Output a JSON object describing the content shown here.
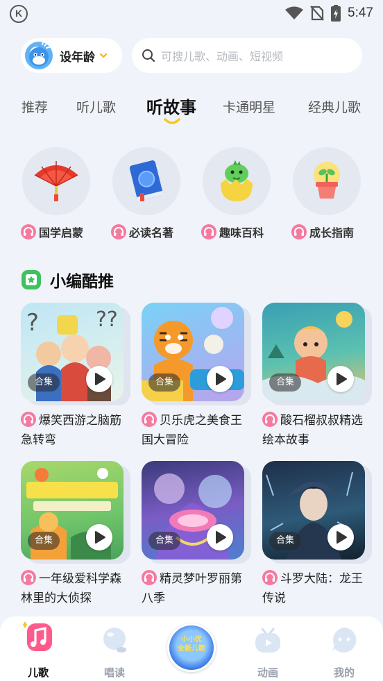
{
  "status_bar": {
    "app_logo": "K",
    "time": "5:47"
  },
  "header": {
    "age_label": "设年龄",
    "search_placeholder": "可搜儿歌、动画、短视频"
  },
  "tabs": [
    {
      "label": "推荐",
      "active": false
    },
    {
      "label": "听儿歌",
      "active": false
    },
    {
      "label": "听故事",
      "active": true
    },
    {
      "label": "卡通明星",
      "active": false
    },
    {
      "label": "经典儿歌",
      "active": false
    }
  ],
  "categories": [
    {
      "label": "国学启蒙",
      "icon": "folding-fan-icon"
    },
    {
      "label": "必读名著",
      "icon": "book-icon"
    },
    {
      "label": "趣味百科",
      "icon": "dinosaur-egg-icon"
    },
    {
      "label": "成长指南",
      "icon": "sprout-pot-icon"
    }
  ],
  "section": {
    "title": "小编酷推"
  },
  "cards": [
    {
      "title": "爆笑西游之脑筋急转弯",
      "badge": "合集"
    },
    {
      "title": "贝乐虎之美食王国大冒险",
      "badge": "合集"
    },
    {
      "title": "酸石榴叔叔精选绘本故事",
      "badge": "合集"
    },
    {
      "title": "一年级爱科学森林里的大侦探",
      "badge": "合集"
    },
    {
      "title": "精灵梦叶罗丽第八季",
      "badge": "合集"
    },
    {
      "title": "斗罗大陆：龙王传说",
      "badge": "合集"
    }
  ],
  "bottom_nav": [
    {
      "label": "儿歌",
      "icon": "music-note-icon",
      "active": true
    },
    {
      "label": "唱读",
      "icon": "bubble-icon",
      "active": false
    },
    {
      "label": "动画",
      "icon": "tv-icon",
      "active": false
    },
    {
      "label": "我的",
      "icon": "chat-face-icon",
      "active": false
    }
  ],
  "center_button": {
    "text_line1": "小小优",
    "text_line2": "全新儿歌"
  },
  "colors": {
    "accent_yellow": "#f7c81e",
    "headphone_pink": "#f47aa0",
    "section_green": "#3ec25f"
  }
}
